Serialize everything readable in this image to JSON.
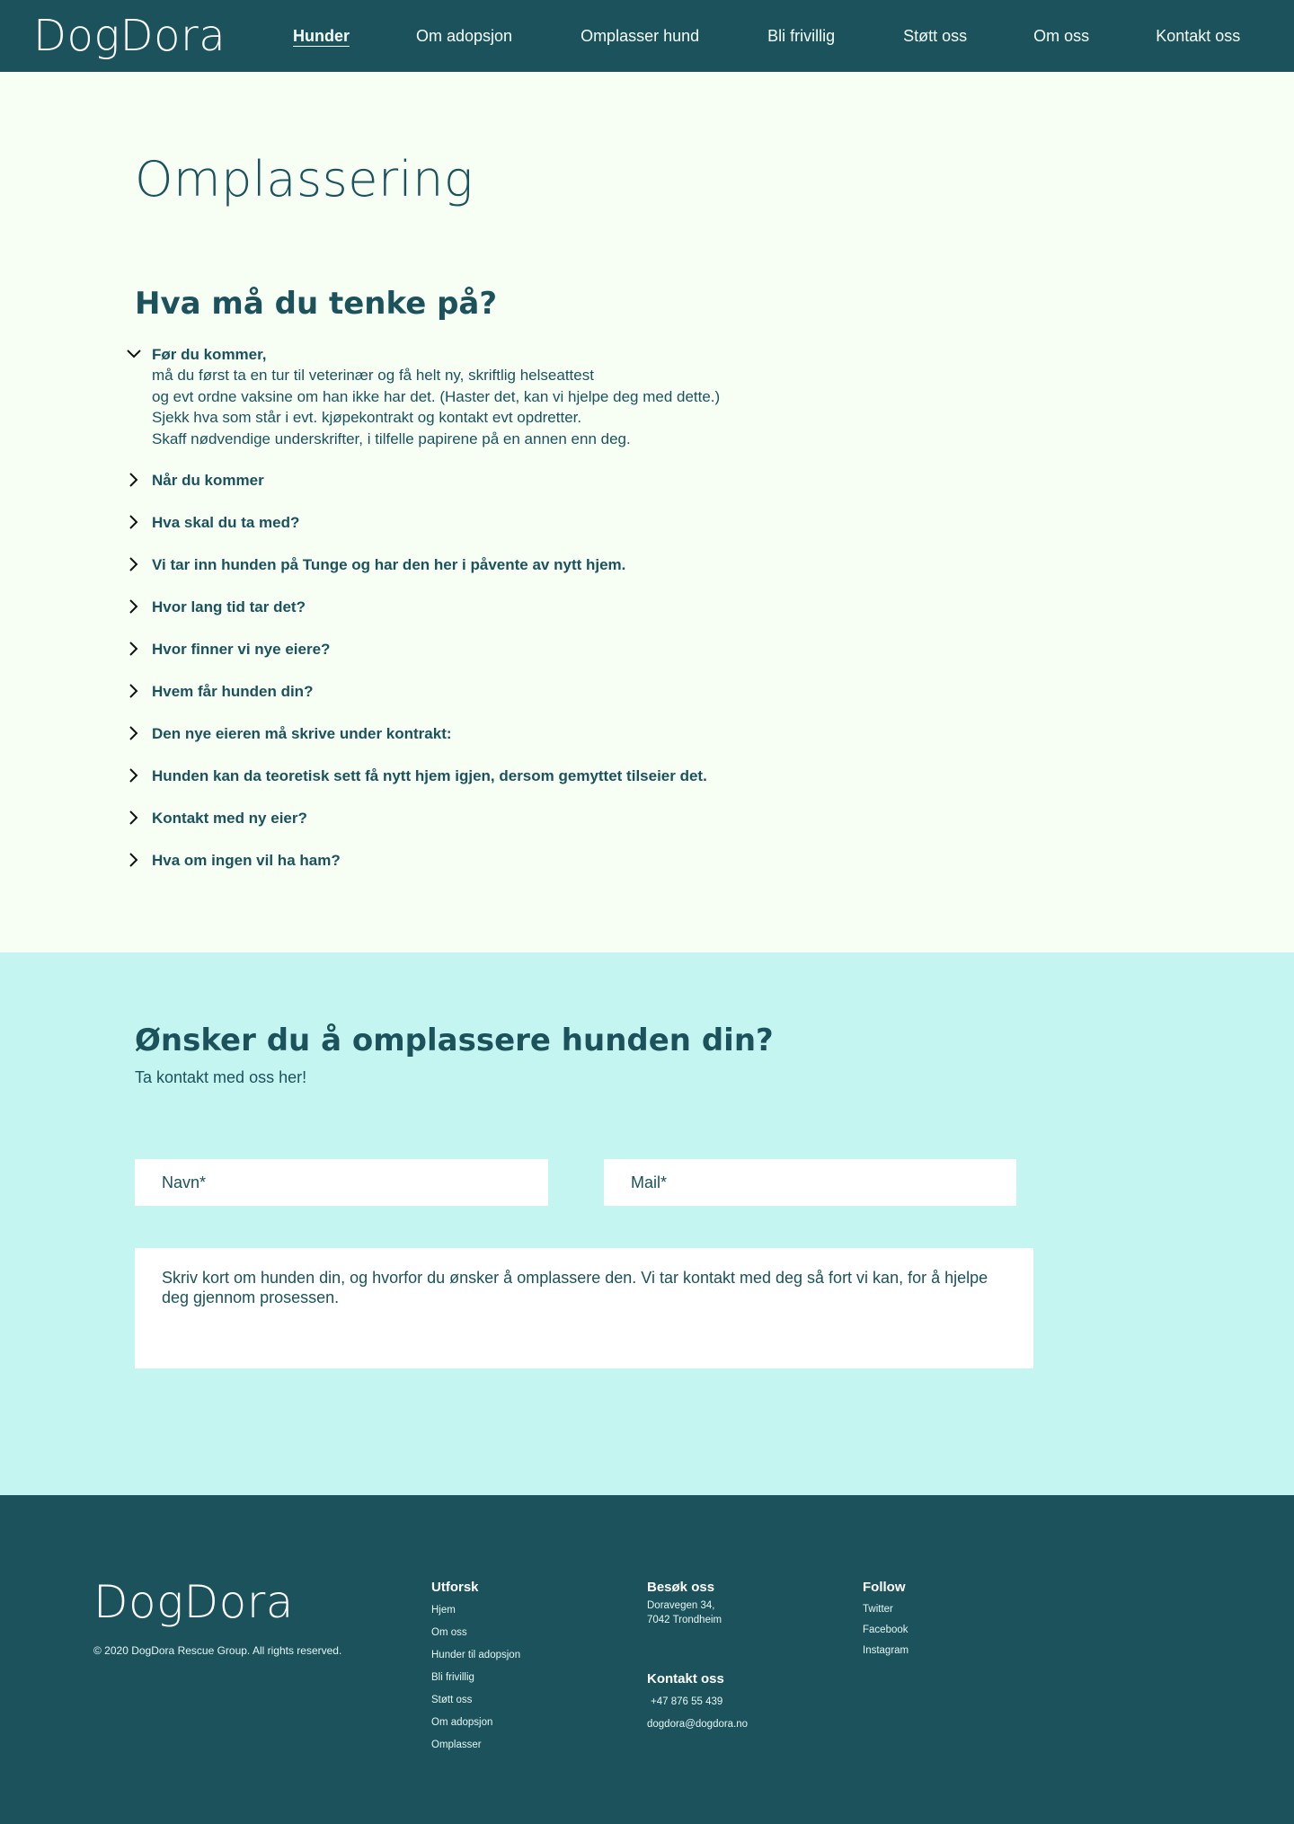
{
  "header": {
    "logo": "DogDora",
    "nav": [
      {
        "label": "Hunder",
        "active": true
      },
      {
        "label": "Om adopsjon"
      },
      {
        "label": "Omplasser hund"
      },
      {
        "label": "Bli frivillig"
      },
      {
        "label": "Støtt oss"
      },
      {
        "label": "Om oss"
      },
      {
        "label": "Kontakt oss"
      }
    ]
  },
  "main": {
    "title": "Omplassering",
    "section_title": "Hva må du tenke på?",
    "faq": [
      {
        "question": "Før du kommer,",
        "expanded": true,
        "answer_lines": [
          "må du først ta en tur til veterinær og få helt ny, skriftlig helseattest",
          "og evt ordne vaksine om han ikke har det. (Haster det, kan vi hjelpe deg med dette.)",
          "Sjekk hva som står i evt. kjøpekontrakt og kontakt evt opdretter.",
          "Skaff nødvendige underskrifter, i tilfelle papirene på en annen enn deg."
        ]
      },
      {
        "question": "Når du kommer"
      },
      {
        "question": "Hva skal du ta med?"
      },
      {
        "question": "Vi tar inn hunden på Tunge og har den her i påvente av nytt hjem."
      },
      {
        "question": "Hvor lang tid tar det?"
      },
      {
        "question": "Hvor finner vi nye eiere?"
      },
      {
        "question": "Hvem får hunden din?"
      },
      {
        "question": "Den nye eieren må skrive under kontrakt:"
      },
      {
        "question": "Hunden kan da teoretisk sett få nytt hjem igjen, dersom gemyttet tilseier det."
      },
      {
        "question": "Kontakt med ny eier?"
      },
      {
        "question": "Hva om ingen vil ha ham?"
      }
    ]
  },
  "contact": {
    "title": "Ønsker du å omplassere hunden din?",
    "subtitle": "Ta kontakt med oss her!",
    "name_placeholder": "Navn*",
    "mail_placeholder": "Mail*",
    "message_placeholder": "Skriv kort om hunden din, og hvorfor du ønsker å omplassere den. Vi tar kontakt med deg så fort vi kan, for å hjelpe deg gjennom prosessen."
  },
  "footer": {
    "logo": "DogDora",
    "copyright": "© 2020 DogDora Rescue Group. All rights reserved.",
    "explore": {
      "title": "Utforsk",
      "links": [
        "Hjem",
        "Om oss",
        "Hunder til adopsjon",
        "Bli frivillig",
        "Støtt oss",
        "Om adopsjon",
        "Omplasser"
      ]
    },
    "visit": {
      "title": "Besøk oss",
      "address_line1": "Doravegen 34,",
      "address_line2": "7042 Trondheim"
    },
    "contact": {
      "title": "Kontakt oss",
      "phone": "+47 876 55 439",
      "email": "dogdora@dogdora.no"
    },
    "follow": {
      "title": "Follow",
      "links": [
        "Twitter",
        "Facebook",
        "Instagram"
      ]
    }
  },
  "colors": {
    "primary": "#1b525c",
    "page_bg": "#f7fff5",
    "contact_bg": "#c4f5f0"
  },
  "icons": {
    "collapsed": "chevron-right-icon",
    "expanded": "chevron-down-icon"
  }
}
